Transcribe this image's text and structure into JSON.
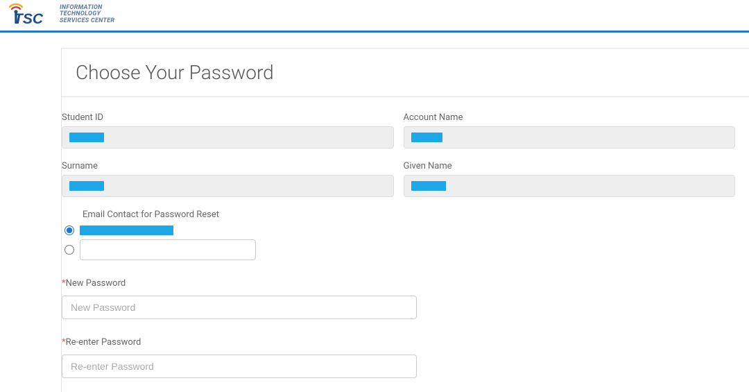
{
  "header": {
    "org_line1": "INFORMATION",
    "org_line2": "TECHNOLOGY",
    "org_line3": "SERVICES CENTER"
  },
  "panel": {
    "title": "Choose Your Password"
  },
  "fields": {
    "student_id_label": "Student ID",
    "account_name_label": "Account Name",
    "surname_label": "Surname",
    "given_name_label": "Given Name"
  },
  "email_section": {
    "heading": "Email Contact for Password Reset",
    "option2_value": ""
  },
  "password": {
    "new_label": "New Password",
    "new_placeholder": "New Password",
    "reenter_label": "Re-enter Password",
    "reenter_placeholder": "Re-enter Password",
    "required_mark": "*"
  }
}
